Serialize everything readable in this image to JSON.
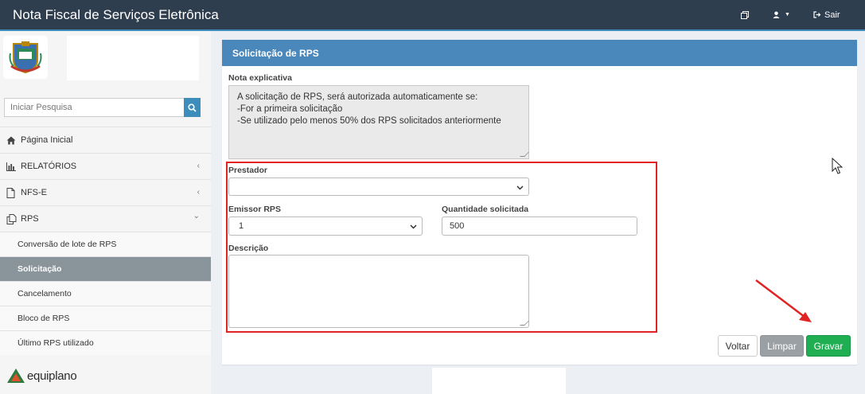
{
  "header": {
    "title": "Nota Fiscal de Serviços Eletrônica",
    "exit_label": "Sair"
  },
  "sidebar": {
    "search": {
      "placeholder": "Iniciar Pesquisa"
    },
    "menu": [
      {
        "label": "Página Inicial",
        "icon": "home-icon"
      },
      {
        "label": "RELATÓRIOS",
        "icon": "bar-chart-icon",
        "chevron": "‹"
      },
      {
        "label": "NFS-E",
        "icon": "file-icon",
        "chevron": "‹"
      },
      {
        "label": "RPS",
        "icon": "copy-icon",
        "chevron": "⌄"
      }
    ],
    "submenu": [
      {
        "label": "Conversão de lote de RPS"
      },
      {
        "label": "Solicitação",
        "active": true
      },
      {
        "label": "Cancelamento"
      },
      {
        "label": "Bloco de RPS"
      },
      {
        "label": "Último RPS utilizado"
      }
    ],
    "footer_brand": "equiplano"
  },
  "panel": {
    "title": "Solicitação de RPS",
    "note_label": "Nota explicativa",
    "note_lines": [
      "A solicitação de RPS, será autorizada automaticamente se:",
      "-For a primeira solicitação",
      "-Se utilizado pelo menos 50% dos RPS solicitados anteriormente"
    ],
    "prestador_label": "Prestador",
    "prestador_value": "",
    "emissor_label": "Emissor RPS",
    "emissor_value": "1",
    "quantidade_label": "Quantidade solicitada",
    "quantidade_value": "500",
    "descricao_label": "Descrição",
    "descricao_value": "",
    "buttons": {
      "voltar": "Voltar",
      "limpar": "Limpar",
      "gravar": "Gravar"
    }
  },
  "colors": {
    "header_bg": "#2f3e4f",
    "panel_head": "#4a88bc",
    "active_item": "#8a949b",
    "gravar": "#1fae52",
    "limpar": "#9aa0a3",
    "highlight": "#e02424"
  }
}
